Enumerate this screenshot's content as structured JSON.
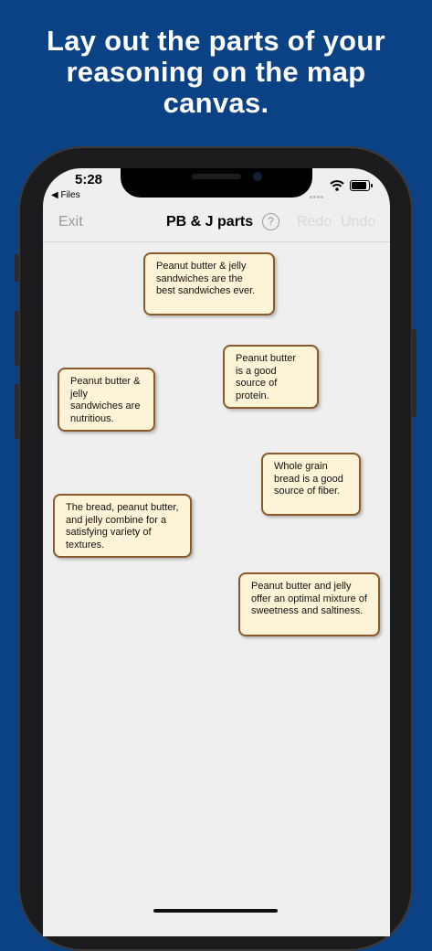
{
  "headline": {
    "line1": "Lay out the parts of your",
    "line2": "reasoning on the map",
    "line3": "canvas."
  },
  "status_bar": {
    "time": "5:28",
    "back_label": "◀ Files"
  },
  "nav": {
    "exit": "Exit",
    "title": "PB & J parts",
    "help": "?",
    "redo": "Redo",
    "undo": "Undo"
  },
  "cards": [
    {
      "text": "Peanut butter & jelly sandwiches are the best sandwiches ever."
    },
    {
      "text": "Peanut butter is a good source of protein."
    },
    {
      "text": "Peanut butter & jelly sandwiches are nutritious."
    },
    {
      "text": "Whole grain bread is a good source of fiber."
    },
    {
      "text": "The bread, peanut butter, and jelly combine for a satisfying variety of textures."
    },
    {
      "text": "Peanut butter and jelly offer an optimal mixture of sweetness and saltiness."
    }
  ],
  "colors": {
    "background": "#0b4185",
    "card_fill": "#fdf3d6",
    "card_border": "#8a5a2b",
    "canvas": "#efeff0"
  }
}
